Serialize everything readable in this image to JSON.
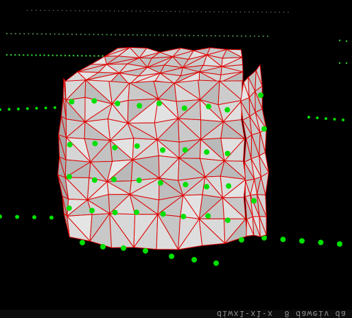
{
  "viewport": {
    "background": "#000000",
    "mesh_fill": "#cfcfcf",
    "mesh_shade": "#a9a9a9",
    "mesh_edge_color": "#e00000",
    "point_color": "#00e000"
  },
  "status_bar": {
    "text": "diwx1-x1-x  8 daweiv da"
  }
}
